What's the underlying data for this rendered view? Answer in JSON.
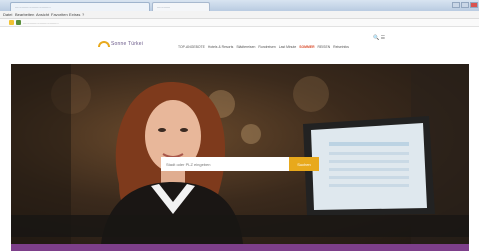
{
  "browser": {
    "tabs": [
      {
        "label": "................................"
      },
      {
        "label": "............"
      }
    ],
    "menu": [
      "Datei",
      "Bearbeiten",
      "Ansicht",
      "Favoriten",
      "Extras",
      "?"
    ],
    "bookmark_label": "................................"
  },
  "site": {
    "logo_text": "Sonne Türkei",
    "utility_icons": "🔍 ☰",
    "nav": [
      {
        "label": "TOP-ANGEBOTE"
      },
      {
        "label": "Hotels & Resorts"
      },
      {
        "label": "Städtereisen"
      },
      {
        "label": "Rundreisen"
      },
      {
        "label": "Last Minute"
      },
      {
        "label": "SOMMER",
        "highlight": true
      },
      {
        "label": "REISEN"
      },
      {
        "label": "Reiseinfos"
      }
    ]
  },
  "search": {
    "placeholder": "Stadt oder PLZ eingeben",
    "button_label": "Suchen"
  },
  "colors": {
    "accent": "#e8a91c",
    "brand_purple": "#7d3f8a"
  }
}
